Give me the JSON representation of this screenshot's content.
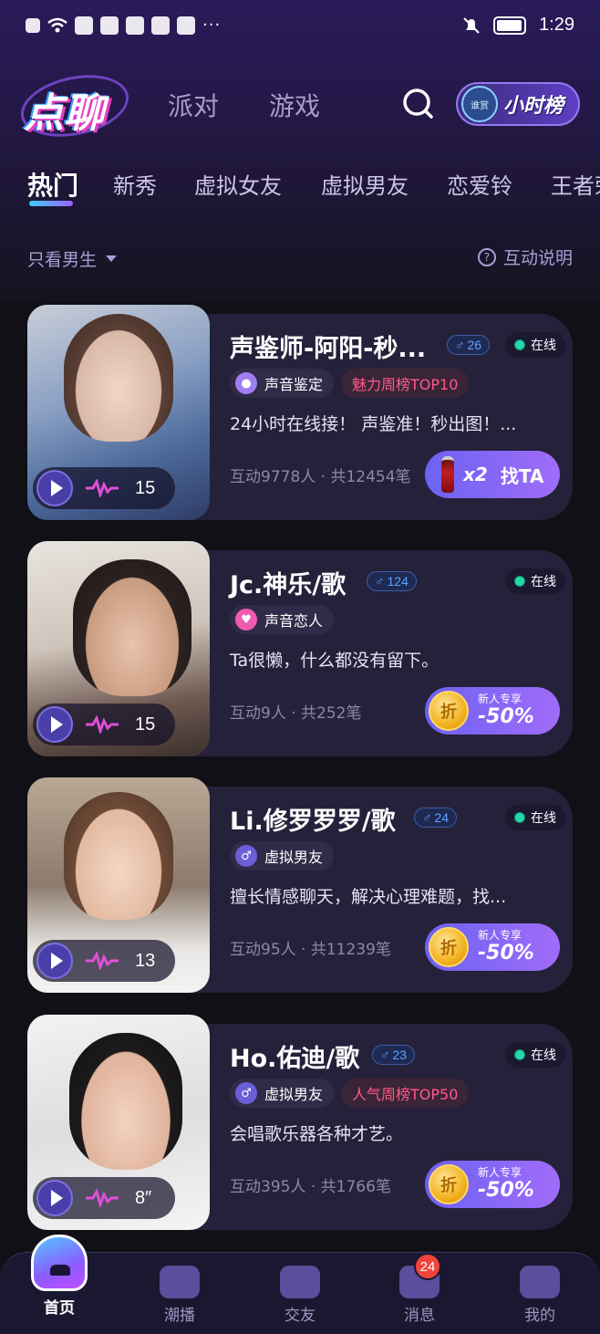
{
  "status_bar": {
    "time": "1:29"
  },
  "header": {
    "logo": "点聊",
    "tabs": [
      "派对",
      "游戏"
    ],
    "rank_badge": "谁赏",
    "rank_label": "小时榜"
  },
  "categories": [
    "热门",
    "新秀",
    "虚拟女友",
    "虚拟男友",
    "恋爱铃",
    "王者荣"
  ],
  "filter": {
    "label": "只看男生",
    "help": "互动说明"
  },
  "cards": [
    {
      "name": "声鉴师-阿阳-秒...",
      "age": "26",
      "online": "在线",
      "tags": [
        {
          "label": "声音鉴定",
          "icon": "mic-icon"
        }
      ],
      "hot_tag": "魅力周榜TOP10",
      "desc": "24小时在线接！ 声鉴准！秒出图！...",
      "stats": "互动9778人 · 共12454笔",
      "duration": "15",
      "cta": {
        "type": "find",
        "x2": "x2",
        "label": "找TA"
      }
    },
    {
      "name": "Jc.神乐/歌",
      "age": "124",
      "online": "在线",
      "tags": [
        {
          "label": "声音恋人",
          "icon": "heart-icon"
        }
      ],
      "hot_tag": "",
      "desc": "Ta很懒，什么都没有留下。",
      "stats": "互动9人 · 共252笔",
      "duration": "15",
      "cta": {
        "type": "discount",
        "coin": "折",
        "small": "新人专享",
        "big": "-50%"
      }
    },
    {
      "name": "Li.修罗罗罗/歌",
      "age": "24",
      "online": "在线",
      "tags": [
        {
          "label": "虚拟男友",
          "icon": "male-icon"
        }
      ],
      "hot_tag": "",
      "desc": "擅长情感聊天，解决心理难题，找...",
      "stats": "互动95人 · 共11239笔",
      "duration": "13",
      "cta": {
        "type": "discount",
        "coin": "折",
        "small": "新人专享",
        "big": "-50%"
      }
    },
    {
      "name": "Ho.佑迪/歌",
      "age": "23",
      "online": "在线",
      "tags": [
        {
          "label": "虚拟男友",
          "icon": "male-icon"
        }
      ],
      "hot_tag": "人气周榜TOP50",
      "desc": "会唱歌乐器各种才艺。",
      "stats": "互动395人 · 共1766笔",
      "duration": "8″",
      "cta": {
        "type": "discount",
        "coin": "折",
        "small": "新人专享",
        "big": "-50%"
      }
    }
  ],
  "bottom_nav": {
    "items": [
      {
        "label": "首页",
        "icon": "home-icon",
        "active": true
      },
      {
        "label": "潮播",
        "icon": "play-tv-icon"
      },
      {
        "label": "交友",
        "icon": "heart-pulse-icon"
      },
      {
        "label": "消息",
        "icon": "message-icon",
        "badge": "24"
      },
      {
        "label": "我的",
        "icon": "profile-cat-icon"
      }
    ]
  },
  "colors": {
    "accent": "#7c63f2",
    "online": "#26d7a8",
    "hot": "#ff5a86",
    "age": "#5fa2ff"
  }
}
